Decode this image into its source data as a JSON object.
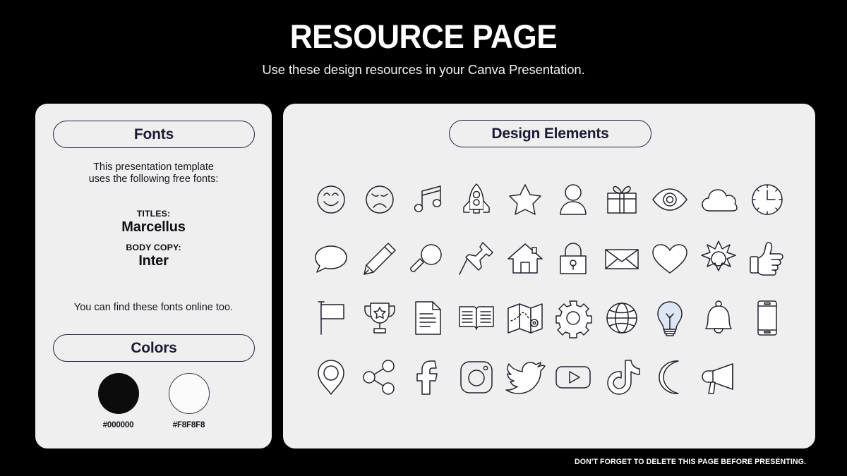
{
  "header": {
    "title": "RESOURCE PAGE",
    "subtitle": "Use these design resources in your Canva Presentation."
  },
  "fonts_card": {
    "heading": "Fonts",
    "intro": "This presentation template\nuses the following free fonts:",
    "intro_line1": "This presentation template",
    "intro_line2": "uses the following free fonts:",
    "titles_label": "TITLES:",
    "titles_font": "Marcellus",
    "body_label": "BODY COPY:",
    "body_font": "Inter",
    "note": "You can find these fonts online too."
  },
  "colors_card": {
    "heading": "Colors",
    "swatches": [
      {
        "name": "black-swatch",
        "hex": "#000000"
      },
      {
        "name": "off-white-swatch",
        "hex": "#F8F8F8"
      }
    ]
  },
  "elements_card": {
    "heading": "Design Elements",
    "icons": [
      "smiley-face-icon",
      "sad-face-icon",
      "music-note-icon",
      "rocket-icon",
      "star-icon",
      "user-icon",
      "gift-icon",
      "eye-icon",
      "cloud-icon",
      "clock-icon",
      "speech-bubble-icon",
      "pencil-icon",
      "magnifying-glass-icon",
      "pushpin-icon",
      "house-icon",
      "lock-icon",
      "envelope-icon",
      "heart-icon",
      "sun-icon",
      "thumbs-up-icon",
      "flag-icon",
      "trophy-icon",
      "document-icon",
      "open-book-icon",
      "map-icon",
      "gear-icon",
      "globe-icon",
      "lightbulb-icon",
      "bell-icon",
      "phone-icon",
      "location-pin-icon",
      "share-icon",
      "facebook-icon",
      "instagram-icon",
      "twitter-icon",
      "youtube-icon",
      "tiktok-icon",
      "moon-icon",
      "megaphone-icon"
    ]
  },
  "footer": {
    "note": "DON'T FORGET TO DELETE THIS PAGE BEFORE PRESENTING."
  },
  "theme": {
    "background": "#000000",
    "card_background": "#EFEFEF",
    "accent_stroke": "#20203A",
    "text_light": "#FFFFFF",
    "icon_stroke": "#23232E",
    "bulb_tint": "#DDE6F5"
  }
}
